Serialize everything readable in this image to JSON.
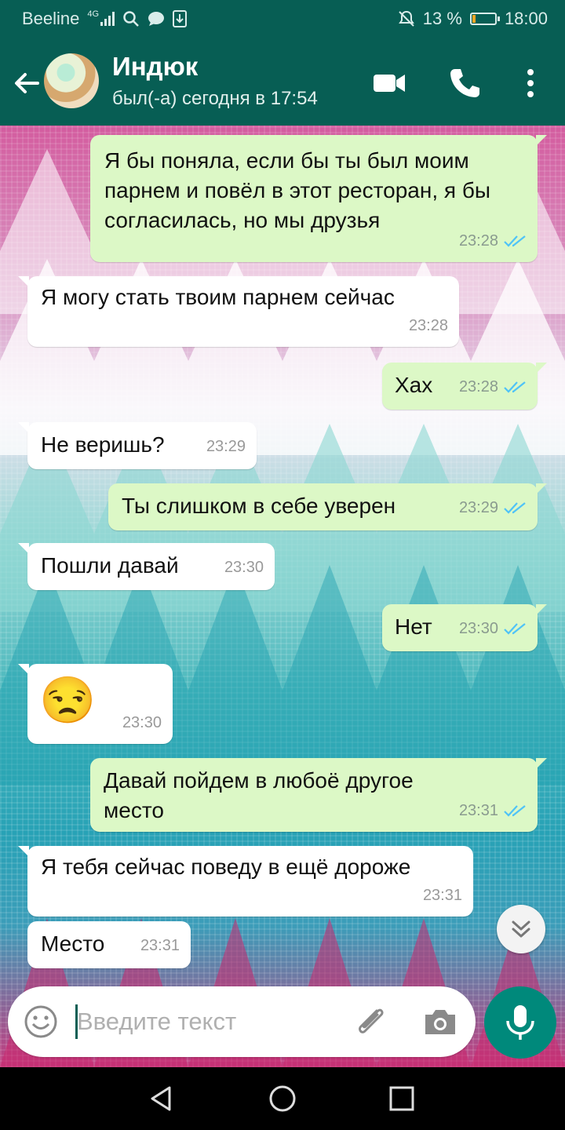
{
  "status_bar": {
    "carrier": "Beeline",
    "network": "4G",
    "battery_percent": "13 %",
    "battery_level": 0.13,
    "time": "18:00"
  },
  "header": {
    "contact_name": "Индюк",
    "last_seen": "был(-а) сегодня в 17:54",
    "icons": [
      "back-arrow-icon",
      "video-call-icon",
      "phone-icon",
      "more-vert-icon"
    ]
  },
  "messages": [
    {
      "dir": "out",
      "text": "Я бы поняла, если бы ты был моим парнем и повёл в этот ресторан, я бы согласилась, но мы друзья",
      "time": "23:28",
      "read": true
    },
    {
      "dir": "in",
      "text": "Я могу стать твоим парнем сейчас",
      "time": "23:28"
    },
    {
      "dir": "out",
      "text": "Хах",
      "time": "23:28",
      "read": true
    },
    {
      "dir": "in",
      "text": "Не веришь?",
      "time": "23:29"
    },
    {
      "dir": "out",
      "text": "Ты слишком в себе уверен",
      "time": "23:29",
      "read": true
    },
    {
      "dir": "in",
      "text": "Пошли давай",
      "time": "23:30"
    },
    {
      "dir": "out",
      "text": "Нет",
      "time": "23:30",
      "read": true
    },
    {
      "dir": "in",
      "text": "😒",
      "time": "23:30"
    },
    {
      "dir": "out",
      "text": "Давай пойдем в любоё другое место",
      "time": "23:31",
      "read": true
    },
    {
      "dir": "in",
      "text": "Я тебя сейчас поведу в ещё дороже",
      "time": "23:31"
    },
    {
      "dir": "in",
      "text": "Место",
      "time": "23:31"
    }
  ],
  "composer": {
    "placeholder": "Введите текст",
    "value": ""
  },
  "colors": {
    "header": "#075E54",
    "outgoing_bubble": "#DCF8C6",
    "incoming_bubble": "#FFFFFF",
    "read_ticks": "#4FC3F7",
    "mic_button": "#00897B"
  }
}
